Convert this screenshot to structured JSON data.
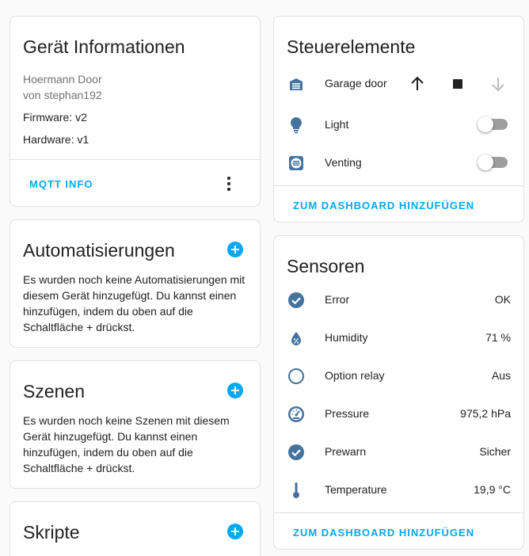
{
  "device_info": {
    "title": "Gerät Informationen",
    "model": "Hoermann Door",
    "manufacturer": "von stephan192",
    "firmware": "Firmware: v2",
    "hardware": "Hardware: v1",
    "mqtt_button": "MQTT INFO",
    "menu_icon": "dots-vertical-icon"
  },
  "automations": {
    "title": "Automatisierungen",
    "text": "Es wurden noch keine Automatisierungen mit diesem Gerät hinzugefügt. Du kannst einen hinzufügen, indem du oben auf die Schaltfläche + drückst."
  },
  "scenes": {
    "title": "Szenen",
    "text": "Es wurden noch keine Szenen mit diesem Gerät hinzugefügt. Du kannst einen hinzufügen, indem du oben auf die Schaltfläche + drückst."
  },
  "scripts": {
    "title": "Skripte"
  },
  "controls": {
    "title": "Steuerelemente",
    "items": [
      {
        "label": "Garage door",
        "icon": "garage-icon"
      },
      {
        "label": "Light",
        "icon": "lightbulb-icon",
        "state": "off"
      },
      {
        "label": "Venting",
        "icon": "vent-icon",
        "state": "off"
      }
    ],
    "add_button": "ZUM DASHBOARD HINZUFÜGEN"
  },
  "sensors": {
    "title": "Sensoren",
    "items": [
      {
        "label": "Error",
        "value": "OK",
        "icon": "check-circle-icon"
      },
      {
        "label": "Humidity",
        "value": "71 %",
        "icon": "water-percent-icon"
      },
      {
        "label": "Option relay",
        "value": "Aus",
        "icon": "circle-outline-icon"
      },
      {
        "label": "Pressure",
        "value": "975,2 hPa",
        "icon": "gauge-icon"
      },
      {
        "label": "Prewarn",
        "value": "Sicher",
        "icon": "check-circle-icon"
      },
      {
        "label": "Temperature",
        "value": "19,9 °C",
        "icon": "thermometer-icon"
      }
    ],
    "add_button": "ZUM DASHBOARD HINZUFÜGEN"
  },
  "colors": {
    "accent": "#03a9f4",
    "icon": "#44739e",
    "toggle_off": "#9e9e9e"
  }
}
